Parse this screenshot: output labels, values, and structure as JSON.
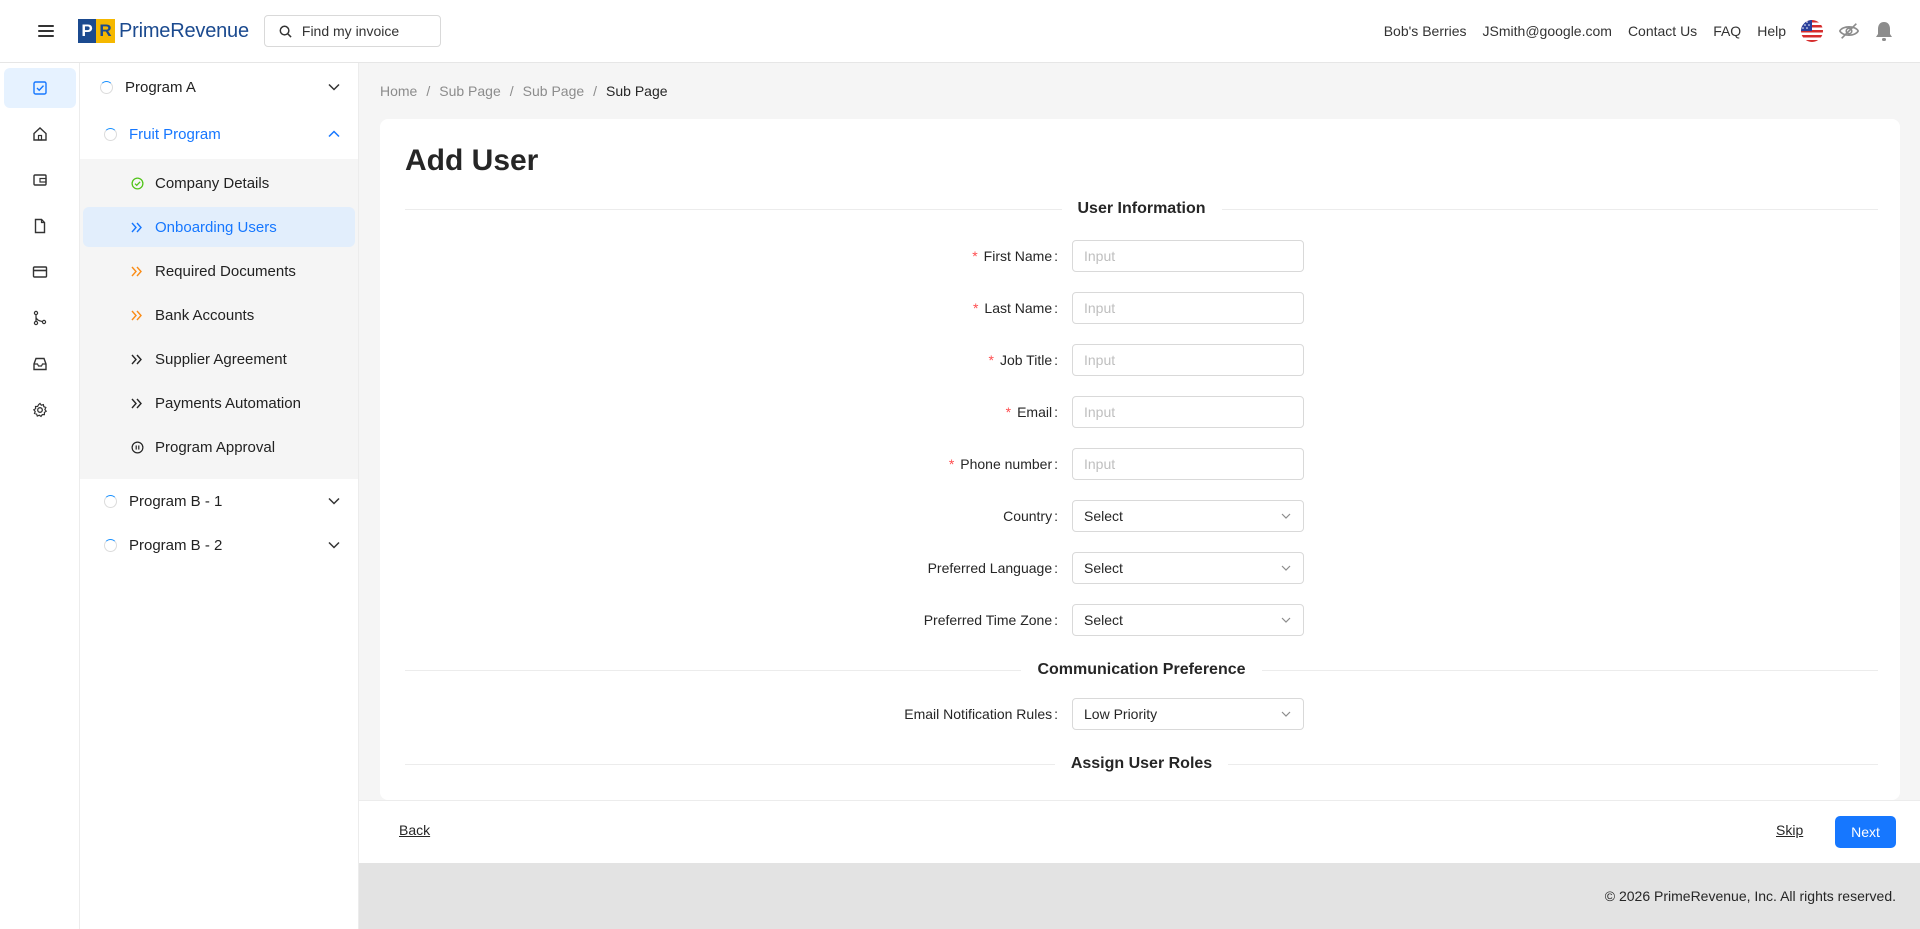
{
  "header": {
    "logo_text": "PrimeRevenue",
    "logo_mark_left": "P",
    "logo_mark_right": "R",
    "search_placeholder": "Find my invoice",
    "links": [
      "Bob's Berries",
      "JSmith@google.com",
      "Contact Us",
      "FAQ",
      "Help"
    ],
    "icons": [
      "us-flag-icon",
      "eye-off-icon",
      "bell-icon"
    ]
  },
  "rail": {
    "items": [
      "checklist-icon",
      "home-icon",
      "wallet-icon",
      "document-icon",
      "credit-card-icon",
      "branch-icon",
      "inbox-icon",
      "settings-icon"
    ],
    "active_index": 0
  },
  "subnav": {
    "programs": [
      {
        "label": "Program A",
        "open": false
      },
      {
        "label": "Fruit Program",
        "open": true
      },
      {
        "label": "Program B - 1",
        "open": false
      },
      {
        "label": "Program B - 2",
        "open": false
      }
    ],
    "fruit_items": [
      {
        "label": "Company Details",
        "icon": "check-circle-icon",
        "color": "#52c41a"
      },
      {
        "label": "Onboarding Users",
        "icon": "double-chevron-icon",
        "color": "#1677ff",
        "active": true
      },
      {
        "label": "Required Documents",
        "icon": "double-chevron-icon",
        "color": "#fa8c16"
      },
      {
        "label": "Bank Accounts",
        "icon": "double-chevron-icon",
        "color": "#fa8c16"
      },
      {
        "label": "Supplier Agreement",
        "icon": "double-chevron-icon",
        "color": "#262626"
      },
      {
        "label": "Payments Automation",
        "icon": "double-chevron-icon",
        "color": "#262626"
      },
      {
        "label": "Program Approval",
        "icon": "pause-circle-icon",
        "color": "#262626"
      }
    ]
  },
  "breadcrumb": {
    "items": [
      "Home",
      "Sub Page",
      "Sub Page"
    ],
    "current": "Sub Page",
    "separator": "/"
  },
  "form": {
    "title": "Add User",
    "section_user": "User Information",
    "section_comm": "Communication Preference",
    "section_roles": "Assign User Roles",
    "required_mark": "*",
    "colon": ":",
    "fields": {
      "first_name": {
        "label": "First Name",
        "placeholder": "Input"
      },
      "last_name": {
        "label": "Last Name",
        "placeholder": "Input"
      },
      "job_title": {
        "label": "Job Title",
        "placeholder": "Input"
      },
      "email": {
        "label": "Email",
        "placeholder": "Input"
      },
      "phone": {
        "label": "Phone number",
        "placeholder": "Input"
      },
      "country": {
        "label": "Country",
        "value": "Select"
      },
      "language": {
        "label": "Preferred Language",
        "value": "Select"
      },
      "timezone": {
        "label": "Preferred Time Zone",
        "value": "Select"
      },
      "email_rules": {
        "label": "Email Notification Rules",
        "value": "Low Priority"
      }
    }
  },
  "actions": {
    "back": "Back",
    "skip": "Skip",
    "next": "Next"
  },
  "footer": {
    "copyright": "© 2026 PrimeRevenue, Inc. All rights reserved."
  },
  "colors": {
    "primary": "#1677ff",
    "required": "#ff4d4f",
    "logo_blue": "#1b4a8f",
    "logo_yellow": "#f5b800"
  }
}
